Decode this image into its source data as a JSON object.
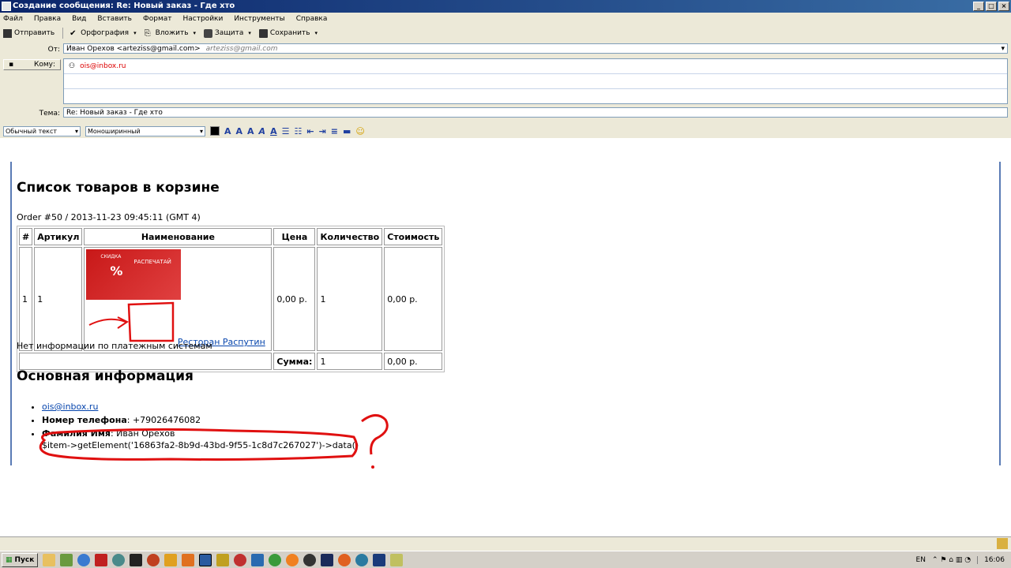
{
  "window": {
    "title": "Создание сообщения: Re: Новый заказ - Где хто"
  },
  "menu": [
    "Файл",
    "Правка",
    "Вид",
    "Вставить",
    "Формат",
    "Настройки",
    "Инструменты",
    "Справка"
  ],
  "toolbar": {
    "send": "Отправить",
    "spelling": "Орфография",
    "attach": "Вложить",
    "security": "Защита",
    "save": "Сохранить"
  },
  "headers": {
    "from_label": "От:",
    "from_value": "Иван Орехов <arteziss@gmail.com>",
    "from_hint": "arteziss@gmail.com",
    "to_button": "Кому:",
    "to_value": "ois@inbox.ru",
    "subject_label": "Тема:",
    "subject_value": "Re: Новый заказ - Где хто"
  },
  "format": {
    "paragraph": "Обычный текст",
    "font": "Моноширинный"
  },
  "body": {
    "cart_title": "Список товаров в корзине",
    "order_line": "Order #50 / 2013-11-23 09:45:11 (GMT 4)",
    "table": {
      "headers": [
        "#",
        "Артикул",
        "Наименование",
        "Цена",
        "Количество",
        "Стоимость"
      ],
      "row": {
        "num": "1",
        "sku": "1",
        "name": "Ресторан Распутин",
        "price": "0,00 р.",
        "qty": "1",
        "cost": "0,00 р."
      },
      "total": {
        "label": "Сумма:",
        "qty": "1",
        "cost": "0,00 р."
      },
      "promo": {
        "text": "СКИДКА",
        "pct": "%",
        "cta": "РАСПЕЧАТАЙ"
      }
    },
    "payment_note": "Нет информации по платежным системам",
    "main_title": "Основная информация",
    "info": {
      "email": "ois@inbox.ru",
      "phone_label": "Номер телефона",
      "phone": ": +79026476082",
      "name_label": "Фамилия Имя",
      "name": ": Иван Орехов",
      "template": "$item->getElement('16863fa2-8b9d-43bd-9f55-1c8d7c267027')->data()"
    }
  },
  "taskbar": {
    "start": "Пуск",
    "lang": "EN",
    "time": "16:06"
  }
}
